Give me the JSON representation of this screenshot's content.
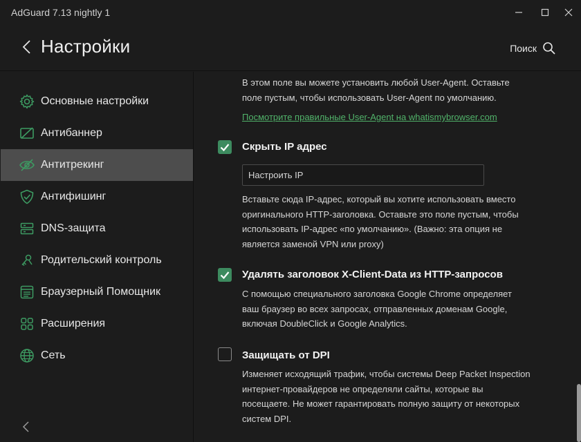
{
  "window": {
    "title": "AdGuard 7.13 nightly 1"
  },
  "header": {
    "title": "Настройки",
    "search_label": "Поиск"
  },
  "sidebar": {
    "items": [
      {
        "label": "Основные настройки",
        "icon": "gear-icon"
      },
      {
        "label": "Антибаннер",
        "icon": "ad-block-icon"
      },
      {
        "label": "Антитрекинг",
        "icon": "eye-off-icon",
        "active": true
      },
      {
        "label": "Антифишинг",
        "icon": "shield-check-icon"
      },
      {
        "label": "DNS-защита",
        "icon": "server-icon"
      },
      {
        "label": "Родительский контроль",
        "icon": "parental-control-icon"
      },
      {
        "label": "Браузерный Помощник",
        "icon": "browser-window-icon"
      },
      {
        "label": "Расширения",
        "icon": "grid-icon"
      },
      {
        "label": "Сеть",
        "icon": "globe-icon"
      }
    ]
  },
  "content": {
    "user_agent_desc": [
      "В этом поле вы можете установить любой User-Agent. Оставьте",
      "поле пустым, чтобы использовать User-Agent по умолчанию."
    ],
    "user_agent_link": "Посмотрите правильные User-Agent на whatismybrowser.com",
    "hide_ip": {
      "title": "Скрыть IP адрес",
      "checked": true,
      "placeholder": "Настроить IP",
      "desc": [
        "Вставьте сюда IP-адрес, который вы хотите использовать вместо",
        "оригинального HTTP-заголовка. Оставьте это поле пустым, чтобы",
        "использовать IP-адрес «по умолчанию». (Важно: эта опция не",
        "является заменой VPN или proxy)"
      ]
    },
    "x_client_data": {
      "title": "Удалять заголовок X-Client-Data из HTTP-запросов",
      "checked": true,
      "desc": [
        "С помощью специального заголовка Google Chrome определяет",
        "ваш браузер во всех запросах, отправленных доменам Google,",
        "включая DoubleClick и Google Analytics."
      ]
    },
    "dpi": {
      "title": "Защищать от DPI",
      "checked": false,
      "desc": [
        "Изменяет исходящий трафик, чтобы системы Deep Packet Inspection",
        "интернет-провайдеров не определяли сайты, которые вы",
        "посещаете. Не может гарантировать полную защиту от некоторых",
        "систем DPI."
      ]
    }
  },
  "colors": {
    "accent": "#3d8b5f",
    "link": "#51b36a",
    "active_bg": "#4d4d4d",
    "background": "#1c1c1c"
  }
}
